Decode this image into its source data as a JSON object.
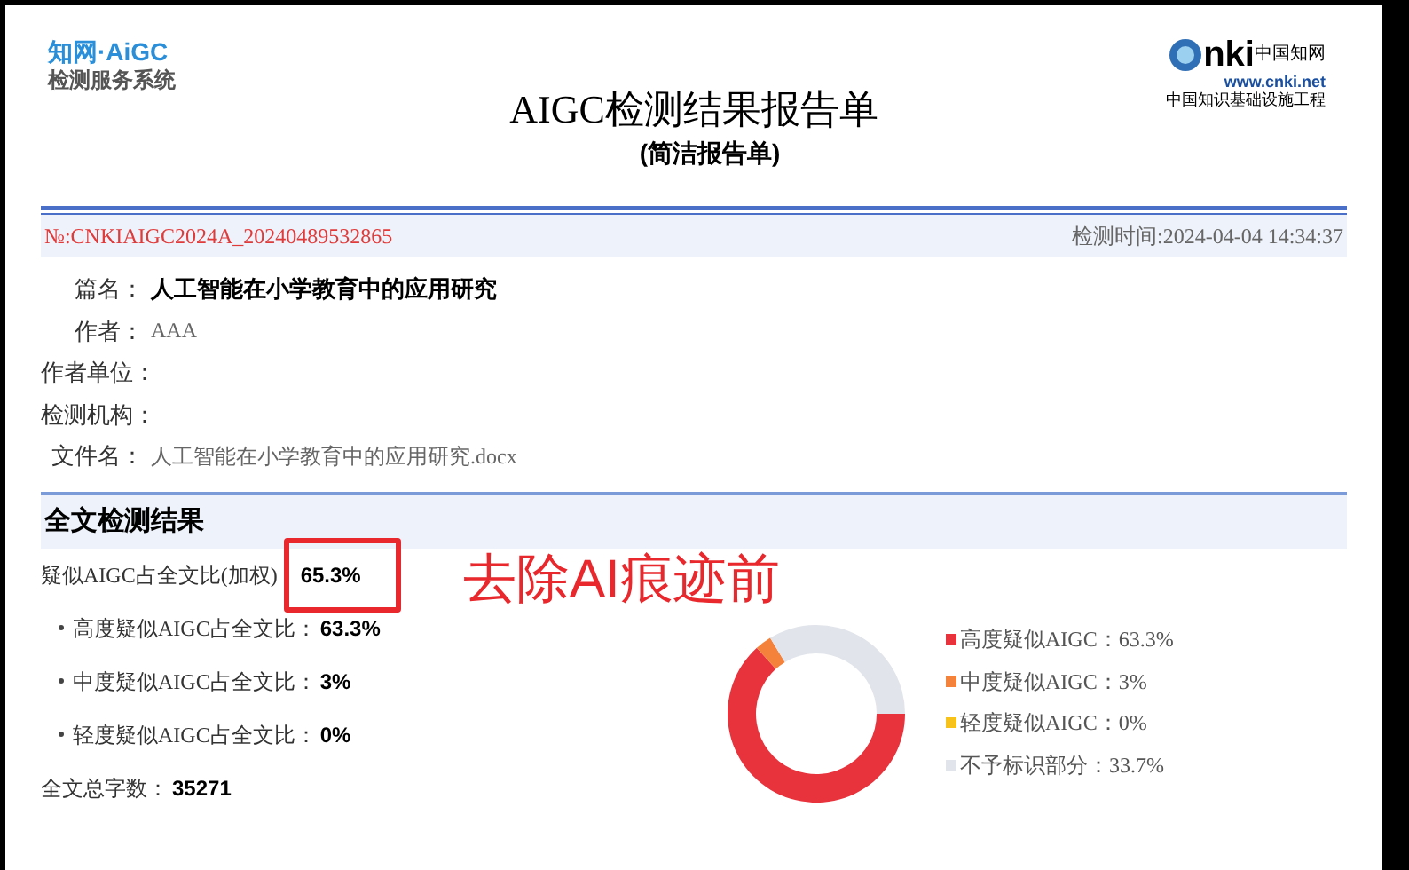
{
  "logo_left": {
    "brand": "知网·AiGC",
    "system": "检测服务系统"
  },
  "logo_right": {
    "letters": "nki",
    "name": "中国知网",
    "url": "www.cnki.net",
    "slogan": "中国知识基础设施工程"
  },
  "title": "AIGC检测结果报告单",
  "subtitle": "(简洁报告单)",
  "report_no": "№:CNKIAIGC2024A_20240489532865",
  "check_time": "检测时间:2024-04-04 14:34:37",
  "fields": [
    {
      "label": "篇名：",
      "value": "人工智能在小学教育中的应用研究",
      "bold": true
    },
    {
      "label": "作者：",
      "value": "AAA",
      "bold": false
    },
    {
      "label": "作者单位："
    },
    {
      "label": "检测机构："
    },
    {
      "label": "文件名：",
      "value": "人工智能在小学教育中的应用研究.docx",
      "bold": false
    }
  ],
  "section_title": "全文检测结果",
  "weighted": {
    "label": "疑似AIGC占全文比(加权)",
    "value": "65.3%",
    "highlighted": true
  },
  "annotation": "去除AI痕迹前",
  "items": [
    {
      "label": "高度疑似AIGC占全文比：",
      "value": "63.3%"
    },
    {
      "label": "中度疑似AIGC占全文比：",
      "value": "3%"
    },
    {
      "label": "轻度疑似AIGC占全文比：",
      "value": "0%"
    }
  ],
  "total": {
    "label": "全文总字数：",
    "value": "35271"
  },
  "legend": [
    {
      "reading": "：63.3%",
      "color": "#e8323c"
    },
    {
      "reading": "：3%",
      "color": "#f5823a"
    },
    {
      "reading": "：0%",
      "color": "#f7c21a"
    },
    {
      "reading": "：33.7%",
      "color": "#e1e4ea"
    }
  ],
  "chart_data": {
    "type": "donut",
    "categories": [
      "高度疑似AIGC",
      "中度疑似AIGC",
      "轻度疑似AIGC",
      "不予标识部分"
    ],
    "values": [
      63.3,
      3,
      0,
      33.7
    ]
  }
}
